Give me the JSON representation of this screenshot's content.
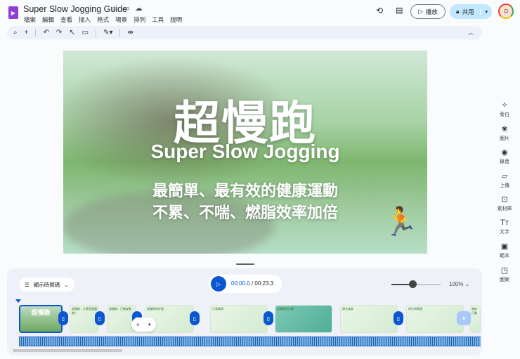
{
  "app": {
    "title": "Super Slow Jogging Guide",
    "menu": [
      "檔案",
      "編輯",
      "查看",
      "插入",
      "格式",
      "場景",
      "排列",
      "工具",
      "說明"
    ]
  },
  "header": {
    "play_label": "播放",
    "share_label": "共用"
  },
  "slide": {
    "title": "超慢跑",
    "subtitle": "Super Slow Jogging",
    "line1": "最簡單、最有效的健康運動",
    "line2": "不累、不喘、燃脂效率加倍"
  },
  "side_panel": [
    {
      "icon": "sparkle-icon",
      "label": "旁白"
    },
    {
      "icon": "image-icon",
      "label": "圖片"
    },
    {
      "icon": "record-icon",
      "label": "錄音"
    },
    {
      "icon": "folder-icon",
      "label": "上傳"
    },
    {
      "icon": "library-icon",
      "label": "素材庫"
    },
    {
      "icon": "text-icon",
      "label": "文字"
    },
    {
      "icon": "template-icon",
      "label": "範本"
    },
    {
      "icon": "shapes-icon",
      "label": "圖案"
    }
  ],
  "timeline": {
    "timecode_toggle": "顯示時間碼",
    "current_time": "00:00.0",
    "total_time": "/ 00:23.3",
    "zoom": "100%",
    "zoom_fraction": 0.4,
    "thumbs": [
      "超慢跑",
      "超慢跑：什麼是超慢跑？",
      "超慢跑：正確姿勢",
      "超慢跑的好處",
      "注意事項",
      "超慢跑的步驟",
      "適合族群",
      "研究與實證",
      "開始行動"
    ]
  }
}
